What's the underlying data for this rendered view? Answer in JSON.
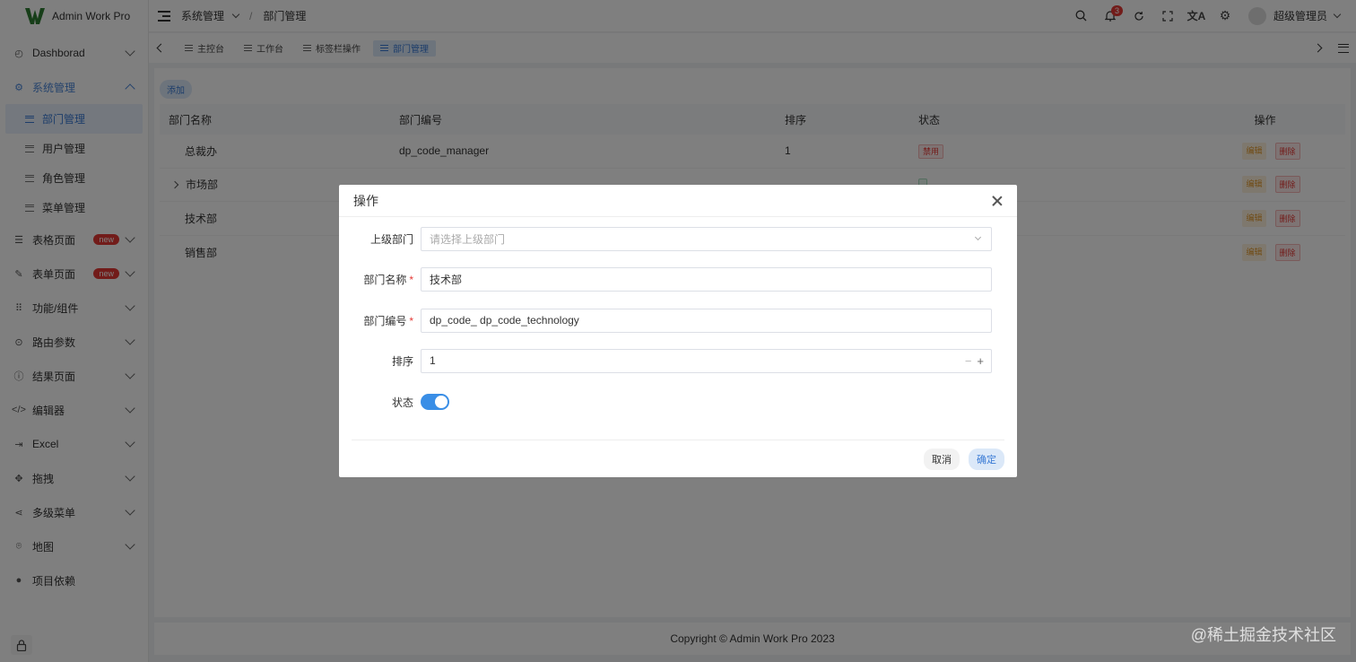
{
  "app": {
    "title": "Admin Work Pro",
    "accent_color": "#3a7bd5"
  },
  "sidebar": {
    "items": [
      {
        "label": "Dashborad",
        "icon": "dashboard-icon"
      },
      {
        "label": "系统管理",
        "icon": "gear-icon",
        "open": true,
        "children": [
          {
            "label": "部门管理",
            "active": true
          },
          {
            "label": "用户管理"
          },
          {
            "label": "角色管理"
          },
          {
            "label": "菜单管理"
          }
        ]
      },
      {
        "label": "表格页面",
        "icon": "table-icon",
        "badge": "new"
      },
      {
        "label": "表单页面",
        "icon": "form-icon",
        "badge": "new"
      },
      {
        "label": "功能/组件",
        "icon": "grid-icon"
      },
      {
        "label": "路由参数",
        "icon": "route-icon"
      },
      {
        "label": "结果页面",
        "icon": "result-icon"
      },
      {
        "label": "编辑器",
        "icon": "code-icon"
      },
      {
        "label": "Excel",
        "icon": "export-icon"
      },
      {
        "label": "拖拽",
        "icon": "move-icon"
      },
      {
        "label": "多级菜单",
        "icon": "share-icon"
      },
      {
        "label": "地图",
        "icon": "location-icon"
      },
      {
        "label": "项目依赖",
        "icon": "package-icon"
      }
    ]
  },
  "header": {
    "breadcrumb": [
      "系统管理",
      "部门管理"
    ],
    "notification_count": "3",
    "user_name": "超级管理员"
  },
  "tabs": [
    {
      "label": "主控台"
    },
    {
      "label": "工作台"
    },
    {
      "label": "标签栏操作"
    },
    {
      "label": "部门管理",
      "active": true
    }
  ],
  "main": {
    "add_label": "添加",
    "columns": [
      "部门名称",
      "部门编号",
      "排序",
      "状态",
      "操作"
    ],
    "rows": [
      {
        "name": "总裁办",
        "code": "dp_code_manager",
        "order": "1",
        "status": "禁用",
        "edit": "编辑",
        "delete": "删除"
      },
      {
        "name": "市场部",
        "code": "",
        "order": "",
        "status": "",
        "edit": "编辑",
        "delete": "删除",
        "expandable": true
      },
      {
        "name": "技术部",
        "code": "",
        "order": "",
        "status": "",
        "edit": "编辑",
        "delete": "删除"
      },
      {
        "name": "销售部",
        "code": "",
        "order": "",
        "status": "",
        "edit": "编辑",
        "delete": "删除"
      }
    ]
  },
  "footer": {
    "copyright": "Copyright © Admin Work Pro 2023"
  },
  "watermark": "@稀土掘金技术社区",
  "modal": {
    "title": "操作",
    "fields": {
      "parent_label": "上级部门",
      "parent_placeholder": "请选择上级部门",
      "name_label": "部门名称",
      "name_value": "技术部",
      "code_label": "部门编号",
      "code_value": "dp_code_ dp_code_technology",
      "order_label": "排序",
      "order_value": "1",
      "status_label": "状态",
      "status_on": true
    },
    "cancel_label": "取消",
    "ok_label": "确定"
  }
}
